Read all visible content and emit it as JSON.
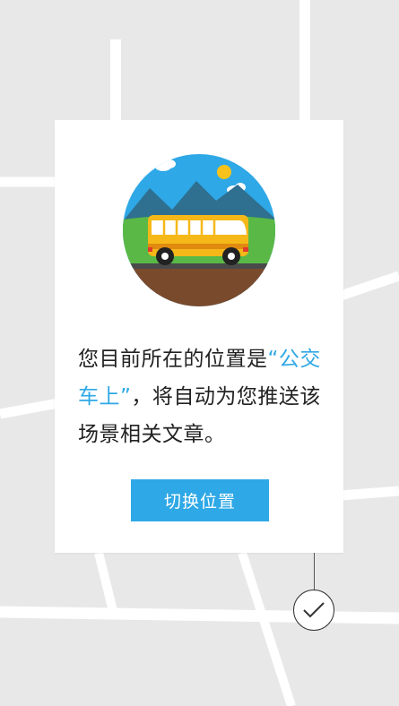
{
  "card": {
    "message_before": "您目前所在的位置是",
    "location_quoted": "“公交车上”",
    "message_after": "，将自动为您推送该场景相关文章。",
    "switch_button_label": "切换位置"
  },
  "illustration": {
    "subject": "bus-icon",
    "sky_color": "#2ea8e6",
    "mountain_color": "#2f6f8f",
    "grass_color": "#5ab946",
    "ground_color": "#7a4a2c",
    "bus_color": "#f5b818",
    "sun_color": "#f9c21a"
  },
  "colors": {
    "accent": "#2ea8e6",
    "map_background": "#e8e8e8",
    "map_roads": "#ffffff"
  },
  "confirm": {
    "icon": "check-icon"
  }
}
